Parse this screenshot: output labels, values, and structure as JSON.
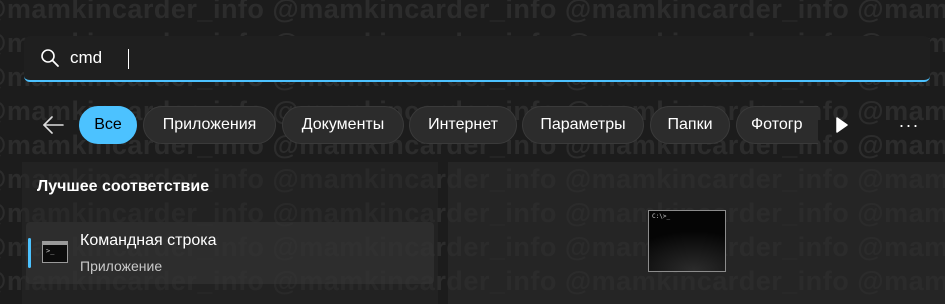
{
  "search": {
    "value": "cmd"
  },
  "filters": {
    "items": [
      {
        "label": "Все",
        "active": true
      },
      {
        "label": "Приложения",
        "active": false
      },
      {
        "label": "Документы",
        "active": false
      },
      {
        "label": "Интернет",
        "active": false
      },
      {
        "label": "Параметры",
        "active": false
      },
      {
        "label": "Папки",
        "active": false
      },
      {
        "label": "Фотогр",
        "active": false
      }
    ],
    "back_icon": "arrow-left-icon",
    "play_icon": "play-icon",
    "more_label": "···"
  },
  "results": {
    "section_title": "Лучшее соответствие",
    "best_match": {
      "title": "Командная строка",
      "subtitle": "Приложение",
      "icon": "command-prompt-icon"
    }
  },
  "watermark": {
    "text": "@mamkincarder_info @mamkincarder_info @mamkincarder_info @mamkincarder_info"
  },
  "colors": {
    "accent": "#4cc2ff",
    "background": "#1c1c1c",
    "chip": "#2c2c2c"
  }
}
